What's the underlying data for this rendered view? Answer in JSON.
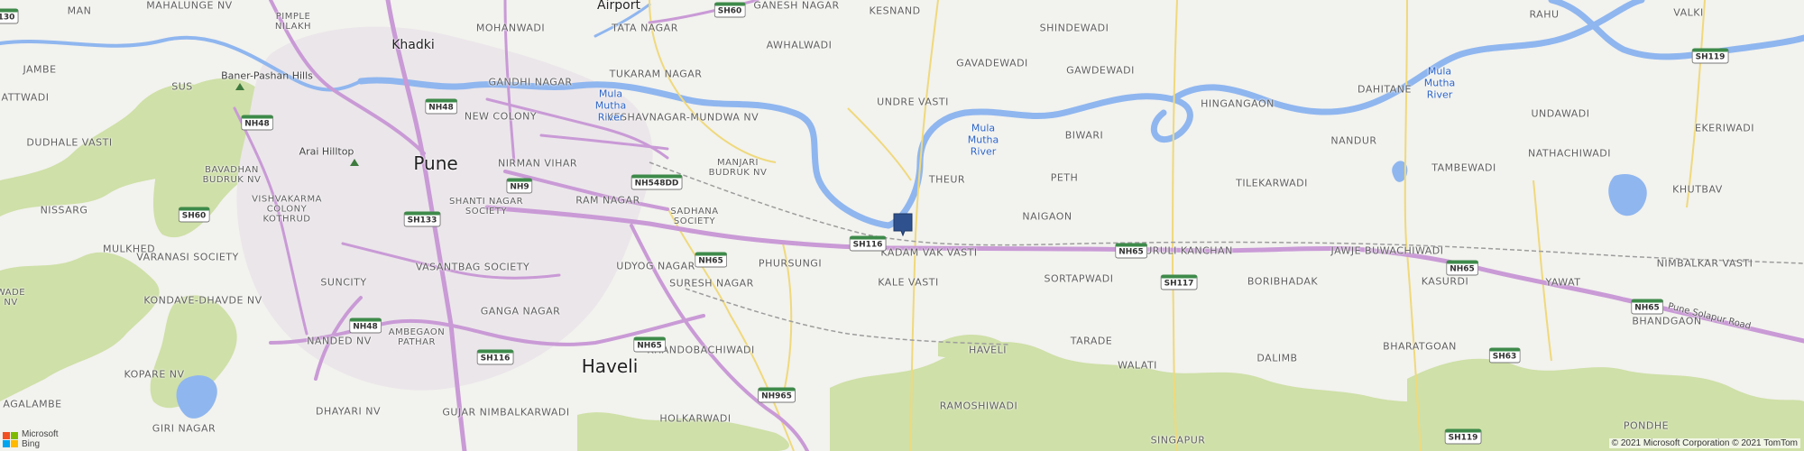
{
  "map": {
    "colors": {
      "land": "#f2f2ee",
      "urban": "#ebe6ea",
      "forest": "#cfe0a8",
      "water": "#8fb6ef",
      "major_road": "#c99ad6",
      "secondary_road": "#efd97c",
      "pushpin": "#2f528f"
    },
    "places": [
      {
        "id": "man",
        "text": "MAN"
      },
      {
        "id": "mahalunge",
        "text": "MAHALUNGE NV"
      },
      {
        "id": "pimple",
        "text": "PIMPLE\nNILAKH"
      },
      {
        "id": "mohanwadi",
        "text": "MOHANWADI"
      },
      {
        "id": "airport",
        "text": "Airport"
      },
      {
        "id": "tata_nagar",
        "text": "TATA NAGAR"
      },
      {
        "id": "ganesh_nagar",
        "text": "GANESH NAGAR"
      },
      {
        "id": "kesnand",
        "text": "KESNAND"
      },
      {
        "id": "shindewadi",
        "text": "SHINDEWADI"
      },
      {
        "id": "rahu",
        "text": "RAHU"
      },
      {
        "id": "valki",
        "text": "VALKI"
      },
      {
        "id": "khadki",
        "text": "Khadki"
      },
      {
        "id": "awhalwadi",
        "text": "AWHALWADI"
      },
      {
        "id": "gavadewadi",
        "text": "GAVADEWADI"
      },
      {
        "id": "gawdewadi",
        "text": "GAWDEWADI"
      },
      {
        "id": "jambe",
        "text": "JAMBE"
      },
      {
        "id": "sus",
        "text": "SUS"
      },
      {
        "id": "gandhi_nagar",
        "text": "GANDHI NAGAR"
      },
      {
        "id": "tukaram_nagar",
        "text": "TUKARAM NAGAR"
      },
      {
        "id": "undre_vasti",
        "text": "UNDRE VASTI"
      },
      {
        "id": "hingangaon",
        "text": "HINGANGAON"
      },
      {
        "id": "dahitane",
        "text": "DAHITANE"
      },
      {
        "id": "undawadi",
        "text": "UNDAWADI"
      },
      {
        "id": "attwadi",
        "text": "ATTWADI"
      },
      {
        "id": "new_colony",
        "text": "NEW COLONY"
      },
      {
        "id": "keshavnagar",
        "text": "KESHAVNAGAR-MUNDWA NV"
      },
      {
        "id": "ekeriwadi",
        "text": "EKERIWADI"
      },
      {
        "id": "dudhale",
        "text": "DUDHALE VASTI"
      },
      {
        "id": "pune",
        "text": "Pune"
      },
      {
        "id": "nirman_vihar",
        "text": "NIRMAN VIHAR"
      },
      {
        "id": "biwari",
        "text": "BIWARI"
      },
      {
        "id": "nandur",
        "text": "NANDUR"
      },
      {
        "id": "nathachiwadi",
        "text": "NATHACHIWADI"
      },
      {
        "id": "bavadhan",
        "text": "BAVADHAN\nBUDRUK NV"
      },
      {
        "id": "manjari",
        "text": "MANJARI\nBUDRUK NV"
      },
      {
        "id": "theur",
        "text": "THEUR"
      },
      {
        "id": "peth",
        "text": "PETH"
      },
      {
        "id": "tilekarwadi",
        "text": "TILEKARWADI"
      },
      {
        "id": "tambewadi",
        "text": "TAMBEWADI"
      },
      {
        "id": "khutbav",
        "text": "KHUTBAV"
      },
      {
        "id": "vishvakarma",
        "text": "VISHVAKARMA\nCOLONY\nKOTHRUD"
      },
      {
        "id": "shanti_nagar",
        "text": "SHANTI NAGAR\nSOCIETY"
      },
      {
        "id": "ram_nagar",
        "text": "RAM NAGAR"
      },
      {
        "id": "sadhana",
        "text": "SADHANA\nSOCIETY"
      },
      {
        "id": "naigaon",
        "text": "NAIGAON"
      },
      {
        "id": "nissarg",
        "text": "NISSARG"
      },
      {
        "id": "mulkhed",
        "text": "MULKHED"
      },
      {
        "id": "phursungi",
        "text": "PHURSUNGI"
      },
      {
        "id": "kadam_vak",
        "text": "KADAM VAK VASTI"
      },
      {
        "id": "uruli",
        "text": "URULI KANCHAN"
      },
      {
        "id": "jawje",
        "text": "JAWJE BUWACHIWADI"
      },
      {
        "id": "varanasi",
        "text": "VARANASI SOCIETY"
      },
      {
        "id": "udyog_nagar",
        "text": "UDYOG NAGAR"
      },
      {
        "id": "vasantbag",
        "text": "VASANTBAG SOCIETY"
      },
      {
        "id": "nimbalkar",
        "text": "NIMBALKAR VASTI"
      },
      {
        "id": "suncity",
        "text": "SUNCITY"
      },
      {
        "id": "suresh_nagar",
        "text": "SURESH NAGAR"
      },
      {
        "id": "kale_vasti",
        "text": "KALE VASTI"
      },
      {
        "id": "sortapwadi",
        "text": "SORTAPWADI"
      },
      {
        "id": "boribhadak",
        "text": "BORIBHADAK"
      },
      {
        "id": "kasurdi",
        "text": "KASURDI"
      },
      {
        "id": "yawat",
        "text": "YAWAT"
      },
      {
        "id": "wade",
        "text": "WADE\nNV"
      },
      {
        "id": "kondave",
        "text": "KONDAVE-DHAVDE NV"
      },
      {
        "id": "ganga_nagar",
        "text": "GANGA NAGAR"
      },
      {
        "id": "ambegaon",
        "text": "AMBEGAON\nPATHAR"
      },
      {
        "id": "nanded",
        "text": "NANDED NV"
      },
      {
        "id": "bhandgaon",
        "text": "BHANDGAON"
      },
      {
        "id": "bharatgoan",
        "text": "BHARATGOAN"
      },
      {
        "id": "haveli_v",
        "text": "HAVELI"
      },
      {
        "id": "tarade",
        "text": "TARADE"
      },
      {
        "id": "khandobachiwadi",
        "text": "KHANDOBACHIWADI"
      },
      {
        "id": "haveli",
        "text": "Haveli"
      },
      {
        "id": "kopare",
        "text": "KOPARE NV"
      },
      {
        "id": "dalimb",
        "text": "DALIMB"
      },
      {
        "id": "walati",
        "text": "WALATI"
      },
      {
        "id": "agalambe",
        "text": "AGALAMBE"
      },
      {
        "id": "dhayari",
        "text": "DHAYARI NV"
      },
      {
        "id": "gujar",
        "text": "GUJAR NIMBALKARWADI"
      },
      {
        "id": "ramoshiwadi",
        "text": "RAMOSHIWADI"
      },
      {
        "id": "pondhe",
        "text": "PONDHE"
      },
      {
        "id": "giri_nagar",
        "text": "GIRI NAGAR"
      },
      {
        "id": "holkarwadi",
        "text": "HOLKARWADI"
      },
      {
        "id": "singapur",
        "text": "SINGAPUR"
      }
    ],
    "pois": [
      {
        "id": "baner",
        "text": "Baner-Pashan Hills"
      },
      {
        "id": "arai",
        "text": "Arai Hilltop"
      }
    ],
    "water_labels": [
      {
        "id": "river1",
        "text": "Mula\nMutha\nRiver"
      },
      {
        "id": "river2",
        "text": "Mula\nMutha\nRiver"
      },
      {
        "id": "river3",
        "text": "Mula\nMutha\nRiver"
      }
    ],
    "road_labels": [
      {
        "id": "pune_solapur",
        "text": "Pune Solapur Road"
      }
    ],
    "shields": [
      {
        "id": "s130",
        "text": "130",
        "kind": "sh"
      },
      {
        "id": "sh60_top",
        "text": "SH60",
        "kind": "sh"
      },
      {
        "id": "sh119_top",
        "text": "SH119",
        "kind": "sh"
      },
      {
        "id": "nh48_a",
        "text": "NH48",
        "kind": "nh"
      },
      {
        "id": "nh48_b",
        "text": "NH48",
        "kind": "nh"
      },
      {
        "id": "nh548dd",
        "text": "NH548DD",
        "kind": "nh"
      },
      {
        "id": "nh9",
        "text": "NH9",
        "kind": "nh"
      },
      {
        "id": "sh60_left",
        "text": "SH60",
        "kind": "sh"
      },
      {
        "id": "sh133",
        "text": "SH133",
        "kind": "sh"
      },
      {
        "id": "sh116_a",
        "text": "SH116",
        "kind": "sh"
      },
      {
        "id": "nh65_a",
        "text": "NH65",
        "kind": "nh"
      },
      {
        "id": "nh65_b",
        "text": "NH65",
        "kind": "nh"
      },
      {
        "id": "sh117",
        "text": "SH117",
        "kind": "sh"
      },
      {
        "id": "nh65_c",
        "text": "NH65",
        "kind": "nh"
      },
      {
        "id": "nh65_d",
        "text": "NH65",
        "kind": "nh"
      },
      {
        "id": "nh48_c",
        "text": "NH48",
        "kind": "nh"
      },
      {
        "id": "sh116_b",
        "text": "SH116",
        "kind": "sh"
      },
      {
        "id": "nh65_e",
        "text": "NH65",
        "kind": "nh"
      },
      {
        "id": "sh63",
        "text": "SH63",
        "kind": "sh"
      },
      {
        "id": "nh965",
        "text": "NH965",
        "kind": "nh"
      },
      {
        "id": "sh119_bot",
        "text": "SH119",
        "kind": "sh"
      }
    ],
    "pushpin_label": "selected location pin",
    "logo": {
      "line1": "Microsoft",
      "line2": "Bing"
    },
    "copyright": "© 2021 Microsoft Corporation © 2021 TomTom"
  }
}
